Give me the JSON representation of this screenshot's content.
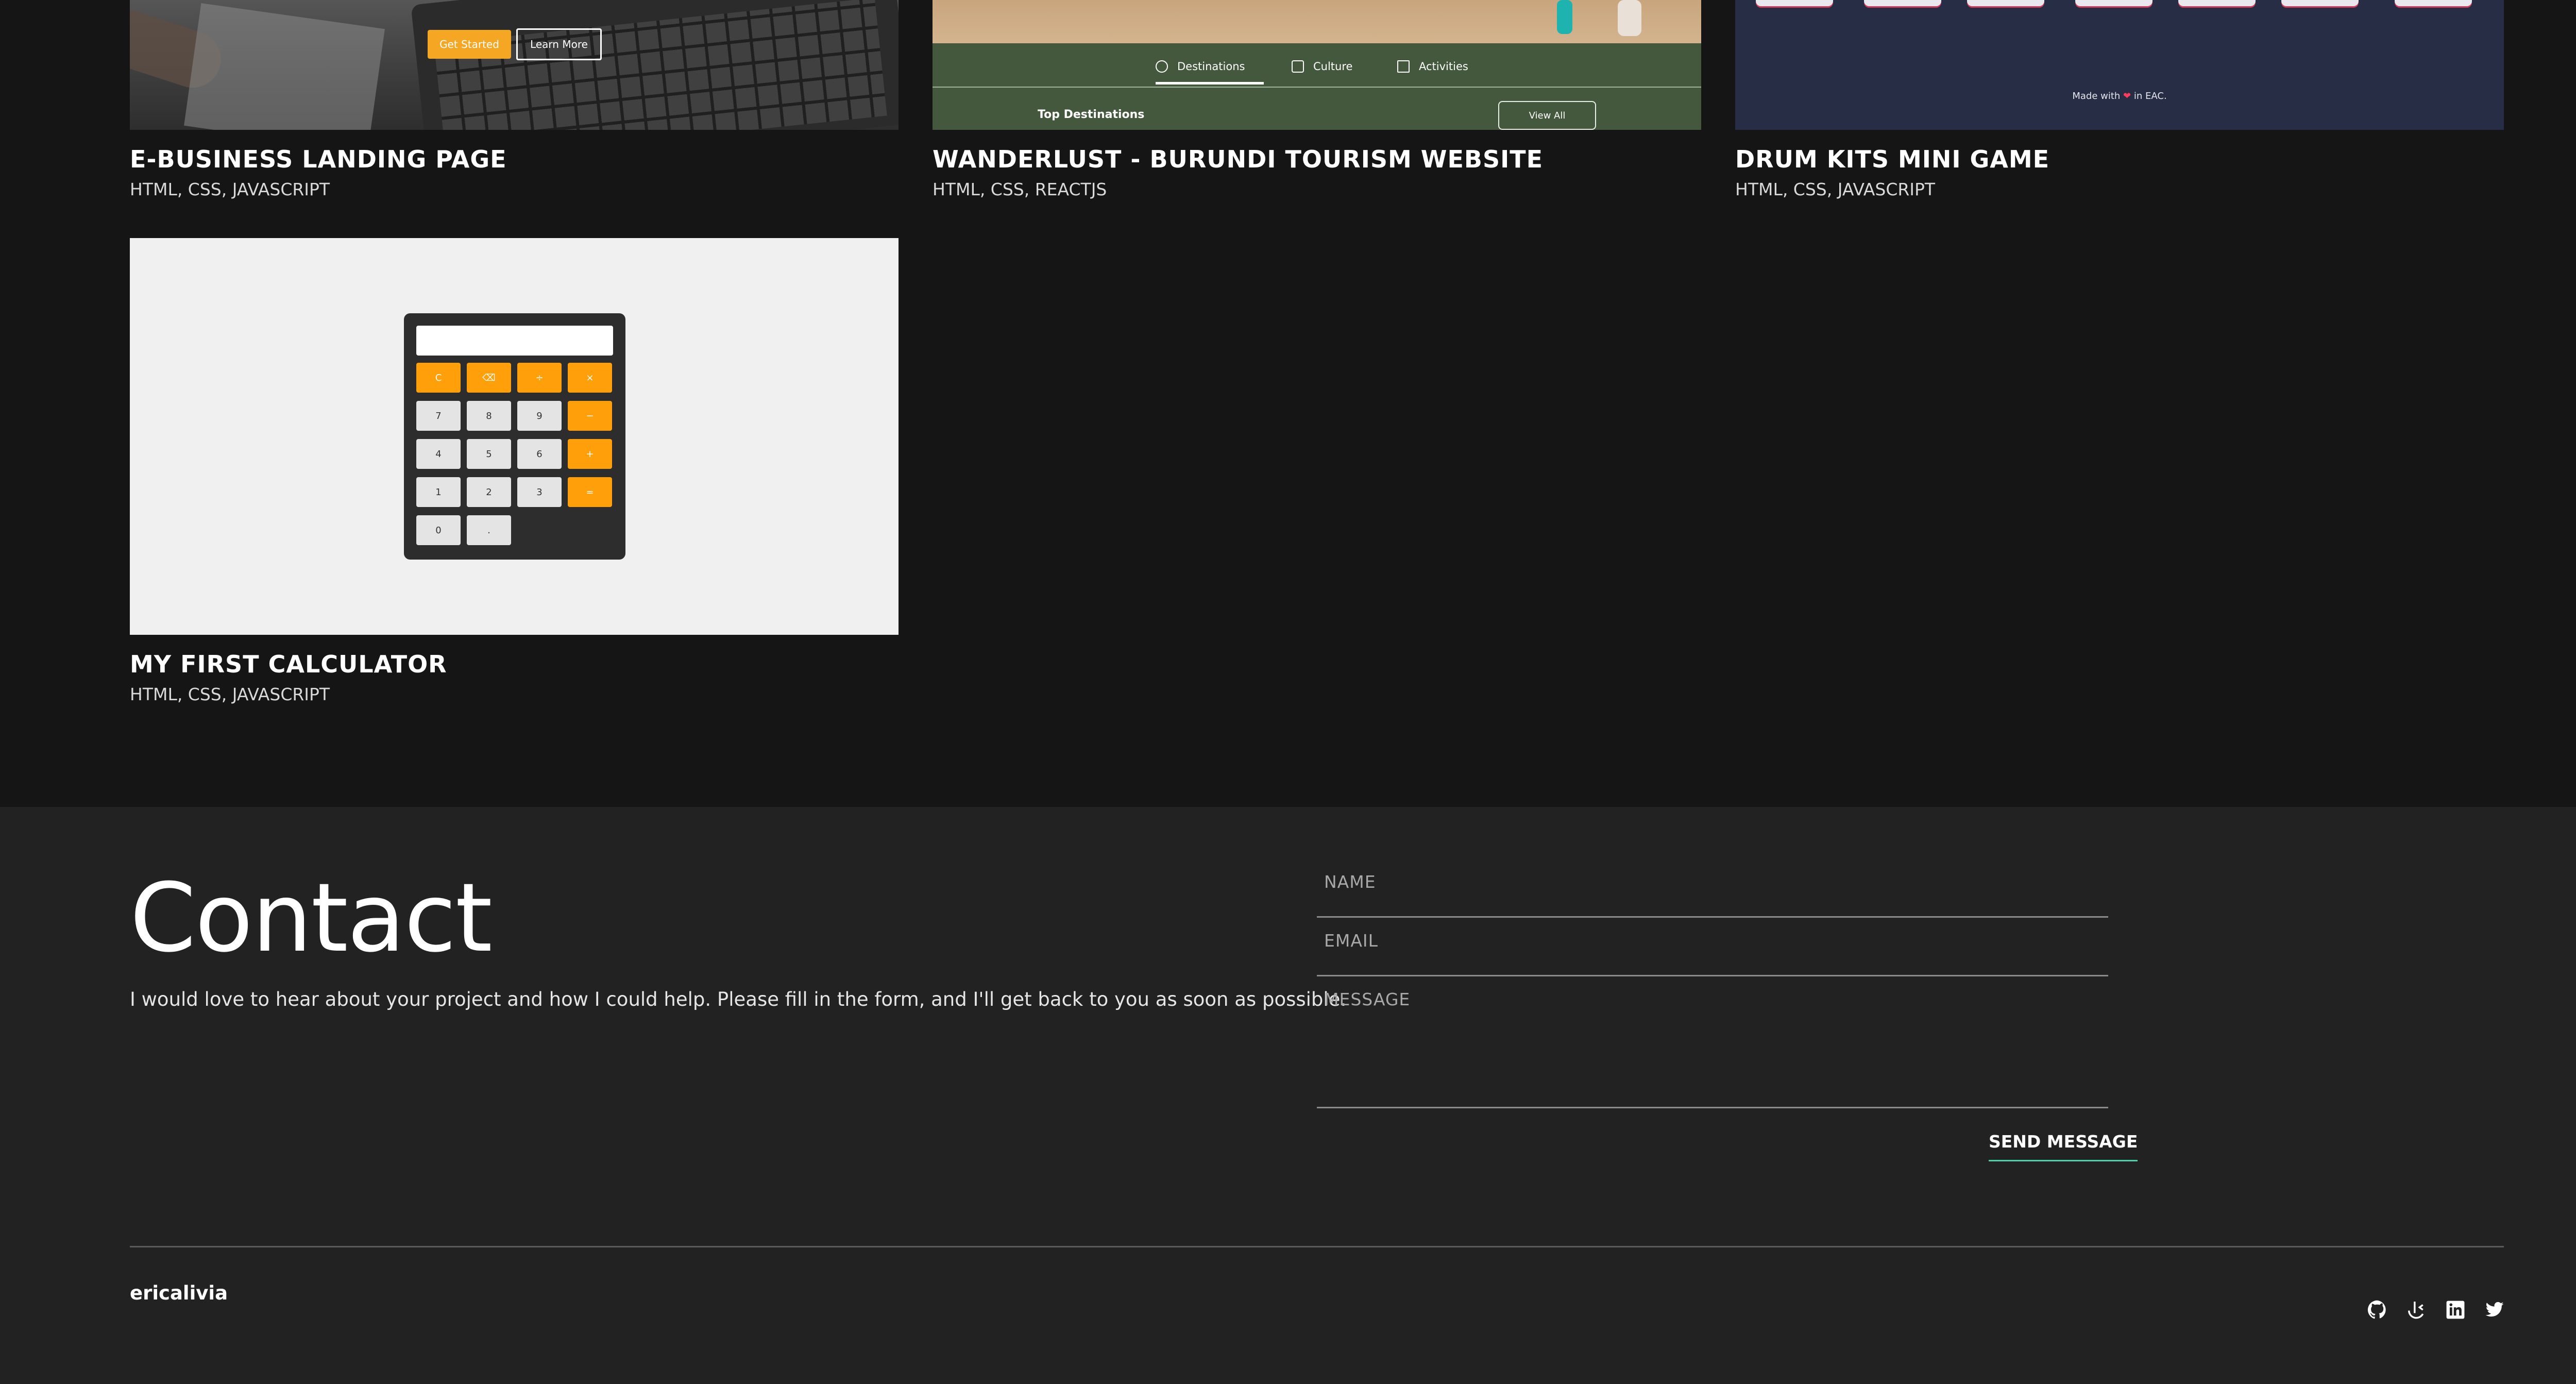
{
  "projects": [
    {
      "title": "E-BUSINESS LANDING PAGE",
      "tech": "HTML, CSS, JAVASCRIPT",
      "preview": {
        "btn_primary": "Get Started",
        "btn_secondary": "Learn More"
      }
    },
    {
      "title": "WANDERLUST - BURUNDI TOURISM WEBSITE",
      "tech": "HTML, CSS, REACTJS",
      "preview": {
        "tabs": [
          "Destinations",
          "Culture",
          "Activities"
        ],
        "section": "Top Destinations",
        "view_all": "View All"
      }
    },
    {
      "title": "DRUM KITS MINI GAME",
      "tech": "HTML, CSS, JAVASCRIPT",
      "preview": {
        "made_prefix": "Made with",
        "heart": "❤",
        "made_suffix": "in EAC."
      }
    },
    {
      "title": "MY FIRST CALCULATOR",
      "tech": "HTML, CSS, JAVASCRIPT",
      "preview": {
        "keys": [
          "C",
          "⌫",
          "÷",
          "×",
          "7",
          "8",
          "9",
          "−",
          "4",
          "5",
          "6",
          "+",
          "1",
          "2",
          "3",
          "=",
          "0",
          "."
        ]
      }
    }
  ],
  "contact": {
    "title": "Contact",
    "text": "I would love to hear about your project and how I could help. Please fill in the form, and I'll get back to you as soon as possible.",
    "name_placeholder": "NAME",
    "email_placeholder": "EMAIL",
    "message_placeholder": "MESSAGE",
    "send_label": "SEND MESSAGE"
  },
  "footer": {
    "brand": "ericalivia",
    "socials": [
      "github-icon",
      "frontend-mentor-icon",
      "linkedin-icon",
      "twitter-icon"
    ]
  },
  "colors": {
    "page_bg": "#151515",
    "contact_bg": "#222222",
    "accent_underline": "#4dd0a7",
    "calc_orange": "#ff9f0a"
  }
}
